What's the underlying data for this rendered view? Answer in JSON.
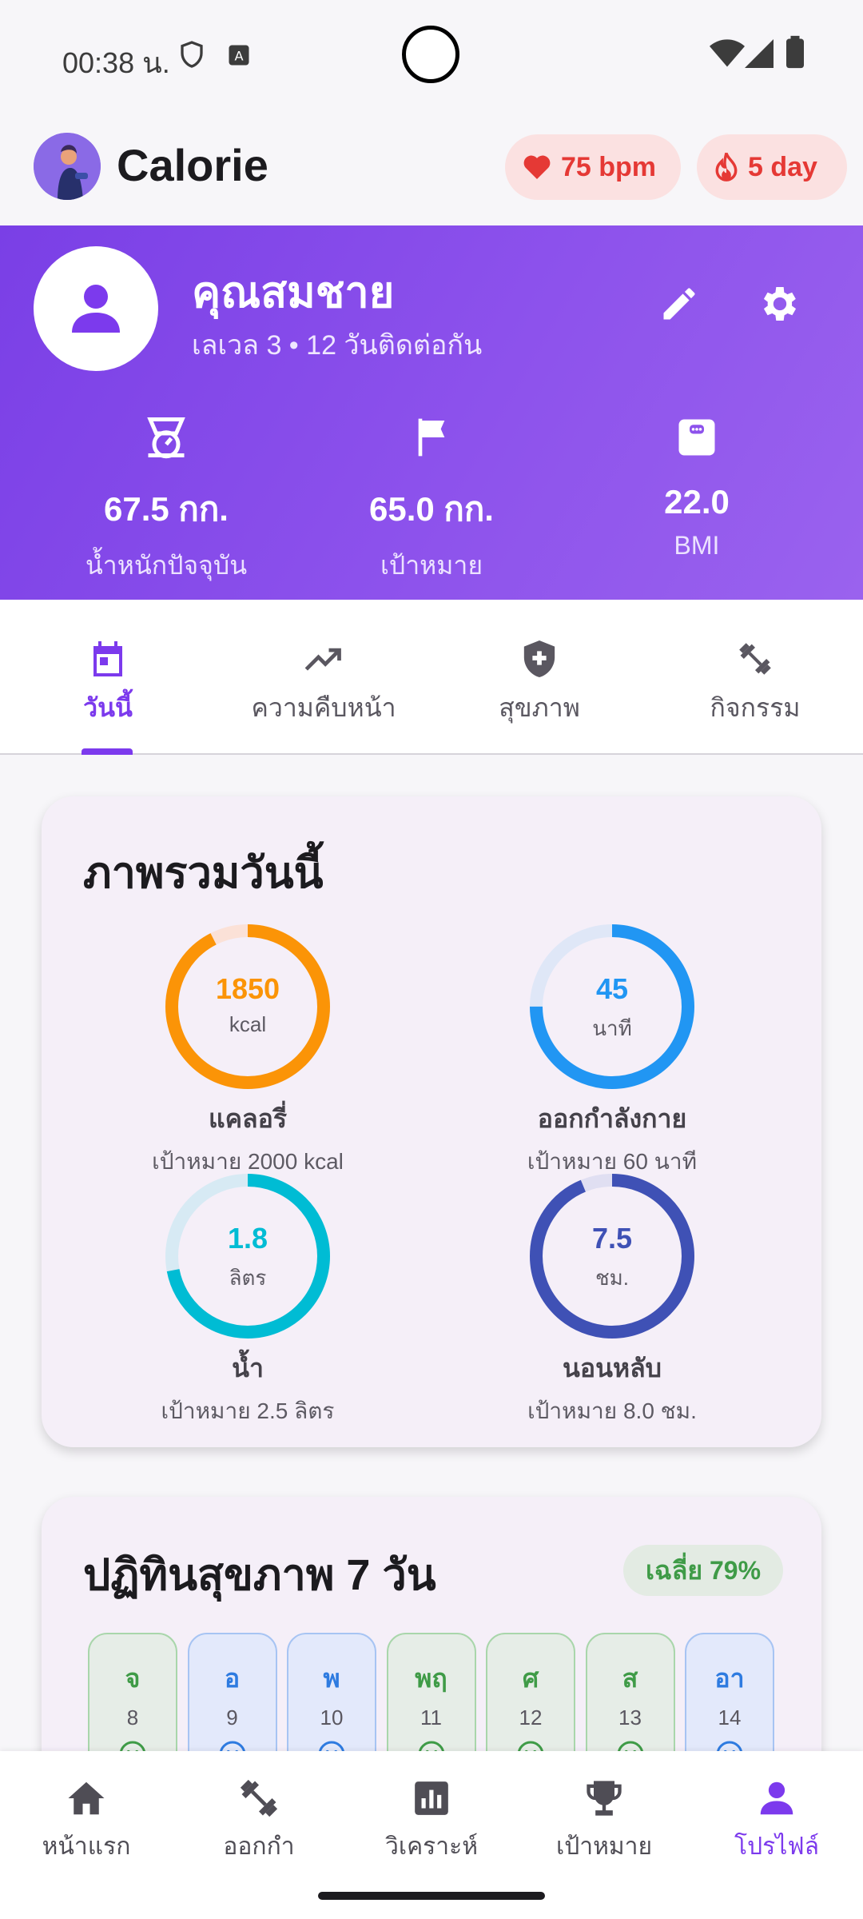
{
  "status": {
    "time": "00:38 น."
  },
  "header": {
    "app_title": "Calorie",
    "heart_rate": "75 bpm",
    "streak": "5 day"
  },
  "profile": {
    "name": "คุณสมชาย",
    "subtitle": "เลเวล 3 • 12 วันติดต่อกัน",
    "stats": [
      {
        "icon": "scale-icon",
        "value": "67.5 กก.",
        "label": "น้ำหนักปัจจุบัน"
      },
      {
        "icon": "flag-icon",
        "value": "65.0 กก.",
        "label": "เป้าหมาย"
      },
      {
        "icon": "bmi-icon",
        "value": "22.0",
        "label": "BMI"
      }
    ]
  },
  "tabs": [
    {
      "label": "วันนี้",
      "icon": "calendar-icon",
      "active": true
    },
    {
      "label": "ความคืบหน้า",
      "icon": "trending-up-icon",
      "active": false
    },
    {
      "label": "สุขภาพ",
      "icon": "health-shield-icon",
      "active": false
    },
    {
      "label": "กิจกรรม",
      "icon": "dumbbell-icon",
      "active": false
    }
  ],
  "overview": {
    "title": "ภาพรวมวันนี้",
    "metrics": [
      {
        "value": "1850",
        "unit": "kcal",
        "label": "แคลอรี่",
        "goal": "เป้าหมาย 2000 kcal",
        "progress": 0.925,
        "color": "#fb9407",
        "track": "#fbe1d7"
      },
      {
        "value": "45",
        "unit": "นาที",
        "label": "ออกกำลังกาย",
        "goal": "เป้าหมาย 60 นาที",
        "progress": 0.75,
        "color": "#2196f3",
        "track": "#dfe7f7"
      },
      {
        "value": "1.8",
        "unit": "ลิตร",
        "label": "น้ำ",
        "goal": "เป้าหมาย 2.5 ลิตร",
        "progress": 0.72,
        "color": "#00bcd4",
        "track": "#d7eaf4"
      },
      {
        "value": "7.5",
        "unit": "ชม.",
        "label": "นอนหลับ",
        "goal": "เป้าหมาย 8.0 ชม.",
        "progress": 0.9375,
        "color": "#3f51b5",
        "track": "#e0dff2"
      }
    ]
  },
  "calendar": {
    "title": "ปฏิทินสุขภาพ 7 วัน",
    "average": "เฉลี่ย 79%",
    "days": [
      {
        "name": "จ",
        "date": "8",
        "tone": "green"
      },
      {
        "name": "อ",
        "date": "9",
        "tone": "blue"
      },
      {
        "name": "พ",
        "date": "10",
        "tone": "blue"
      },
      {
        "name": "พฤ",
        "date": "11",
        "tone": "green"
      },
      {
        "name": "ศ",
        "date": "12",
        "tone": "green"
      },
      {
        "name": "ส",
        "date": "13",
        "tone": "green"
      },
      {
        "name": "อา",
        "date": "14",
        "tone": "blue"
      }
    ]
  },
  "nav": [
    {
      "label": "หน้าแรก",
      "icon": "home-icon",
      "active": false
    },
    {
      "label": "ออกกำ",
      "icon": "dumbbell-icon",
      "active": false
    },
    {
      "label": "วิเคราะห์",
      "icon": "analytics-icon",
      "active": false
    },
    {
      "label": "เป้าหมาย",
      "icon": "trophy-icon",
      "active": false
    },
    {
      "label": "โปรไฟล์",
      "icon": "person-icon",
      "active": true
    }
  ]
}
